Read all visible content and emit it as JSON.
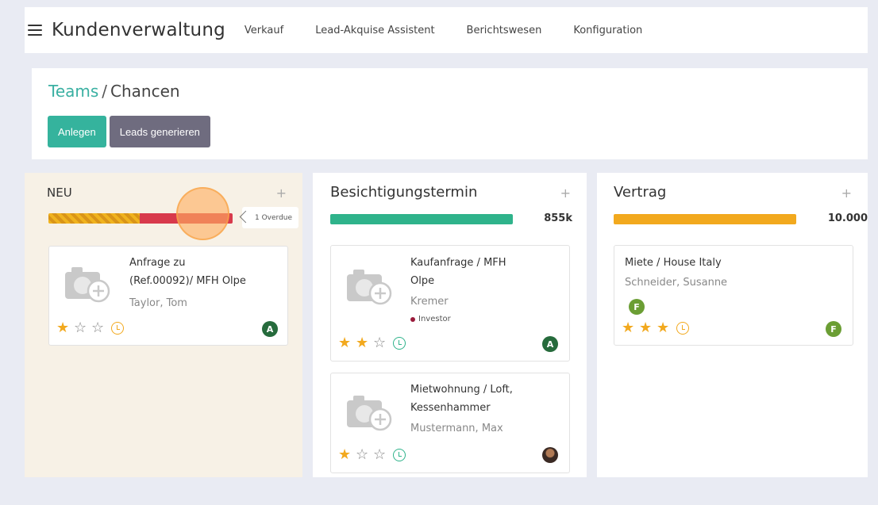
{
  "app": {
    "title": "Kundenverwaltung",
    "menu": [
      "Verkauf",
      "Lead-Akquise Assistent",
      "Berichtswesen",
      "Konfiguration"
    ]
  },
  "breadcrumb": {
    "parent": "Teams",
    "separator": "/",
    "current": "Chancen"
  },
  "buttons": {
    "create": "Anlegen",
    "generate_leads": "Leads generieren"
  },
  "columns": [
    {
      "title": "NEU",
      "plus": "+",
      "overdue_label": "1 Overdue",
      "cards": [
        {
          "title_lines": [
            "Anfrage zu",
            "(Ref.00092)/ MFH Olpe"
          ],
          "customer": "Taylor, Tom",
          "rating": 1,
          "activity_state": "warning",
          "avatar": "A"
        }
      ]
    },
    {
      "title": "Besichtigungstermin",
      "plus": "+",
      "aggregate": "855k",
      "cards": [
        {
          "title_lines": [
            "Kaufanfrage / MFH",
            "Olpe"
          ],
          "customer": "Kremer",
          "tag": "Investor",
          "rating": 2,
          "activity_state": "planned",
          "avatar": "A"
        },
        {
          "title_lines": [
            "Mietwohnung / Loft,",
            "Kessenhammer"
          ],
          "customer": "Mustermann, Max",
          "rating": 1,
          "activity_state": "planned",
          "avatar": "photo"
        }
      ]
    },
    {
      "title": "Vertrag",
      "plus": "+",
      "aggregate": "10.000",
      "cards": [
        {
          "title_lines": [
            "Miete / House Italy"
          ],
          "customer": "Schneider, Susanne",
          "rating": 3,
          "activity_state": "warning",
          "avatar": "F"
        }
      ]
    }
  ],
  "colors": {
    "primary": "#35b39d",
    "secondary": "#6f6c7f",
    "link": "#3ab0a2",
    "progress_green": "#2fb38b",
    "progress_orange": "#f2a91e",
    "progress_red": "#d83a4c",
    "star": "#f2a91e"
  },
  "icons": {
    "menu": "hamburger-icon",
    "thumbnail": "camera-plus-icon",
    "activity": "clock-icon",
    "star_filled": "★",
    "star_empty": "☆"
  }
}
